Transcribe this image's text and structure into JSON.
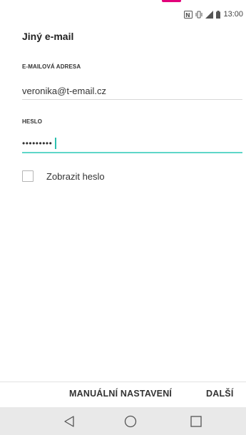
{
  "status_bar": {
    "time": "13:00",
    "icons": [
      "nfc-icon",
      "vibrate-icon",
      "signal-icon",
      "battery-icon"
    ]
  },
  "accent_color": "#e2007a",
  "focus_color": "#5ed6c8",
  "screen": {
    "title": "Jiný e-mail"
  },
  "email": {
    "label": "E-MAILOVÁ ADRESA",
    "value": "veronika@t-email.cz"
  },
  "password": {
    "label": "HESLO",
    "value": "•••••••••"
  },
  "show_password": {
    "label": "Zobrazit heslo",
    "checked": false
  },
  "actions": {
    "manual_label": "MANUÁLNÍ NASTAVENÍ",
    "next_label": "DALŠÍ"
  },
  "nav": {
    "icons": [
      "back-icon",
      "home-icon",
      "recent-apps-icon"
    ]
  }
}
